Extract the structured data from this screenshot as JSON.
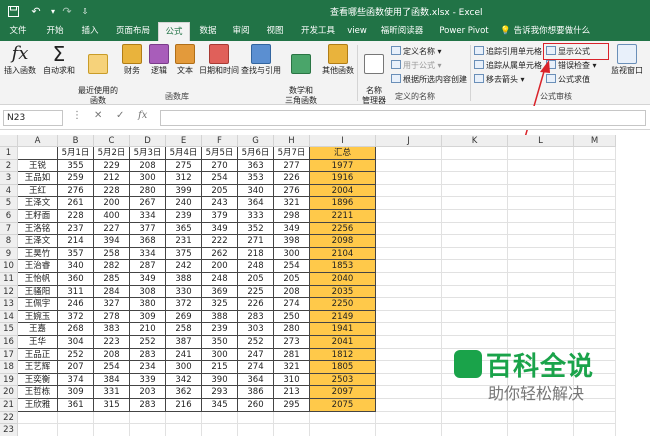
{
  "window": {
    "title": "查看哪些函数使用了函数.xlsx  -  Excel",
    "quick_access": [
      "save-icon",
      "undo-icon",
      "redo-icon",
      "customize-icon"
    ]
  },
  "tabs": [
    "文件",
    "开始",
    "插入",
    "页面布局",
    "公式",
    "数据",
    "审阅",
    "视图",
    "开发工具",
    "view",
    "福昕阅读器",
    "Power Pivot"
  ],
  "active_tab": "公式",
  "tell_me": "告诉我你想要做什么",
  "ribbon": {
    "insert_function": "插入函数",
    "autosum": "自动求和",
    "recent": "最近使用的\n函数",
    "financial": "财务",
    "logical": "逻辑",
    "text": "文本",
    "datetime": "日期和时间",
    "lookup": "查找与引用",
    "math": "数学和\n三角函数",
    "other": "其他函数",
    "name_manager": "名称\n管理器",
    "define_name": "定义名称",
    "use_in_formula": "用于公式",
    "create_from_selection": "根据所选内容创建",
    "trace_precedents": "追踪引用单元格",
    "trace_dependents": "追踪从属单元格",
    "remove_arrows": "移去箭头",
    "show_formulas": "显示公式",
    "error_checking": "错误检查",
    "evaluate_formula": "公式求值",
    "watch_window": "监视窗口",
    "group_library": "函数库",
    "group_names": "定义的名称",
    "group_audit": "公式审核",
    "highlight_color": "#d9232a"
  },
  "formula_bar": {
    "name_box": "N23",
    "fx": "fx",
    "value": ""
  },
  "sheet": {
    "columns": [
      "A",
      "B",
      "C",
      "D",
      "E",
      "F",
      "G",
      "H",
      "I",
      "J",
      "K",
      "L",
      "M"
    ],
    "header_row": [
      "",
      "5月1日",
      "5月2日",
      "5月3日",
      "5月4日",
      "5月5日",
      "5月6日",
      "5月7日",
      "汇总"
    ],
    "rows": [
      [
        "王锐",
        "355",
        "229",
        "208",
        "275",
        "270",
        "363",
        "277",
        "1977"
      ],
      [
        "王品如",
        "259",
        "212",
        "300",
        "312",
        "254",
        "353",
        "226",
        "1916"
      ],
      [
        "王红",
        "276",
        "228",
        "280",
        "399",
        "205",
        "340",
        "276",
        "2004"
      ],
      [
        "王泽文",
        "261",
        "200",
        "267",
        "240",
        "243",
        "364",
        "321",
        "1896"
      ],
      [
        "王籽面",
        "228",
        "400",
        "334",
        "239",
        "379",
        "333",
        "298",
        "2211"
      ],
      [
        "王洛铭",
        "237",
        "227",
        "377",
        "365",
        "349",
        "352",
        "349",
        "2256"
      ],
      [
        "王泽文",
        "214",
        "394",
        "368",
        "231",
        "222",
        "271",
        "398",
        "2098"
      ],
      [
        "王昊竹",
        "357",
        "258",
        "334",
        "375",
        "262",
        "218",
        "300",
        "2104"
      ],
      [
        "王治睿",
        "340",
        "282",
        "287",
        "242",
        "200",
        "248",
        "254",
        "1853"
      ],
      [
        "王怡帆",
        "360",
        "285",
        "349",
        "388",
        "248",
        "205",
        "205",
        "2040"
      ],
      [
        "王骚阳",
        "311",
        "284",
        "308",
        "330",
        "369",
        "225",
        "208",
        "2035"
      ],
      [
        "王佩宇",
        "246",
        "327",
        "380",
        "372",
        "325",
        "226",
        "274",
        "2250"
      ],
      [
        "王婉玉",
        "372",
        "278",
        "309",
        "269",
        "388",
        "283",
        "250",
        "2149"
      ],
      [
        "王嘉",
        "268",
        "383",
        "210",
        "258",
        "239",
        "303",
        "280",
        "1941"
      ],
      [
        "王华",
        "304",
        "223",
        "252",
        "387",
        "350",
        "252",
        "273",
        "2041"
      ],
      [
        "王品正",
        "252",
        "208",
        "283",
        "241",
        "300",
        "247",
        "281",
        "1812"
      ],
      [
        "王艺辉",
        "207",
        "254",
        "234",
        "300",
        "215",
        "274",
        "321",
        "1805"
      ],
      [
        "王奕衡",
        "374",
        "384",
        "339",
        "342",
        "390",
        "364",
        "310",
        "2503"
      ],
      [
        "王哲栋",
        "309",
        "331",
        "203",
        "362",
        "293",
        "386",
        "213",
        "2097"
      ],
      [
        "王欣雅",
        "361",
        "315",
        "283",
        "216",
        "345",
        "260",
        "295",
        "2075"
      ]
    ],
    "extra_rows": [
      "22",
      "23"
    ],
    "summary_color": "#ffc94a"
  },
  "watermark": {
    "main": "百科全说",
    "sub": "助你轻松解决"
  }
}
